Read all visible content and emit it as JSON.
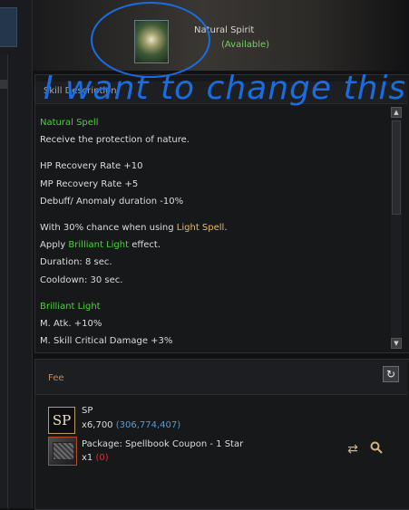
{
  "header": {
    "skill_name": "Natural Spirit",
    "skill_status": "(Available)"
  },
  "annotation": {
    "text": "I want to change this"
  },
  "description": {
    "title": "Skill Description",
    "lines": [
      {
        "text": "Natural Spell",
        "color": "green"
      },
      {
        "text": "Receive the protection of nature."
      },
      {
        "text": "HP Recovery Rate +10"
      },
      {
        "text": "MP Recovery Rate +5"
      },
      {
        "text": "Debuff/ Anomaly duration -10%"
      },
      {
        "before": "With 30% chance when using ",
        "highlight": "Light Spell",
        "after": "."
      },
      {
        "before": "Apply ",
        "highlight": "Brilliant Light",
        "after": " effect."
      },
      {
        "text": "Duration: 8 sec."
      },
      {
        "text": "Cooldown: 30 sec."
      },
      {
        "text": "Brilliant Light",
        "color": "green"
      },
      {
        "text": "M. Atk. +10%"
      },
      {
        "text": "M. Skill Critical Damage +3%"
      }
    ]
  },
  "fee": {
    "title": "Fee",
    "sp": {
      "icon_text": "SP",
      "label": "SP",
      "amount": "x6,700",
      "owned": "(306,774,407)"
    },
    "package": {
      "label": "Package: Spellbook Coupon - 1 Star",
      "amount": "x1",
      "owned": "(0)"
    }
  },
  "icons": {
    "refresh": "refresh-icon",
    "swap": "swap-icon",
    "search": "search-icon"
  },
  "colors": {
    "green_text": "#4ad23c",
    "highlight_text": "#e8b96c",
    "owned_sp": "#4a9ee4",
    "owned_zero": "#e03030",
    "annotation": "#1a6de0"
  }
}
